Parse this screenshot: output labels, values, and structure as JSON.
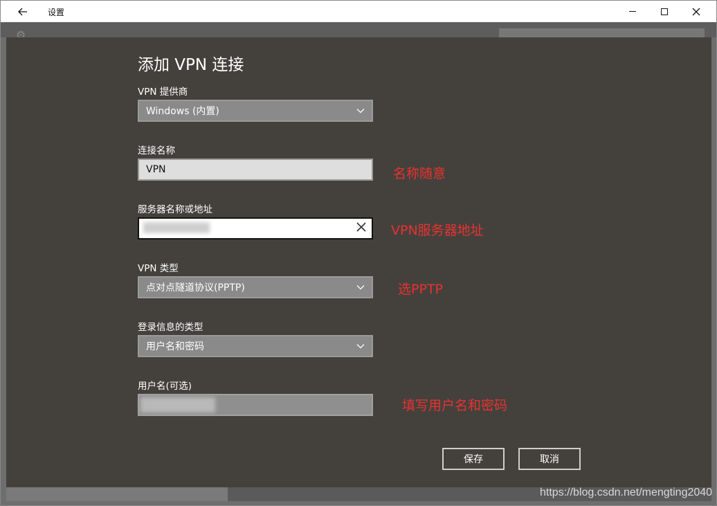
{
  "window": {
    "title": "设置",
    "back_icon": "back-arrow-icon",
    "minimize_icon": "minimize-icon",
    "maximize_icon": "maximize-icon",
    "close_icon": "close-icon"
  },
  "dialog": {
    "title": "添加 VPN 连接",
    "provider": {
      "label": "VPN 提供商",
      "value": "Windows (内置)"
    },
    "connection_name": {
      "label": "连接名称",
      "value": "VPN"
    },
    "server": {
      "label": "服务器名称或地址",
      "value": ""
    },
    "vpn_type": {
      "label": "VPN 类型",
      "value": "点对点隧道协议(PPTP)"
    },
    "signin_type": {
      "label": "登录信息的类型",
      "value": "用户名和密码"
    },
    "username": {
      "label": "用户名(可选)",
      "value": ""
    },
    "save_label": "保存",
    "cancel_label": "取消"
  },
  "annotations": {
    "name": "名称随意",
    "server": "VPN服务器地址",
    "type": "选PPTP",
    "credentials": "填写用户名和密码",
    "color": "#e8322f"
  },
  "watermark": "https://blog.csdn.net/mengting2040"
}
